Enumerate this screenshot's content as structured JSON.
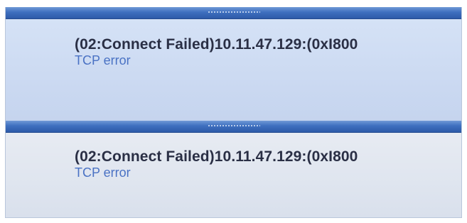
{
  "notifications": [
    {
      "title": "(02:Connect Failed)10.11.47.129:(0xI800",
      "detail": "TCP error"
    },
    {
      "title": "(02:Connect Failed)10.11.47.129:(0xI800",
      "detail": "TCP error"
    }
  ],
  "colors": {
    "header_bar": "#3e6fbf",
    "panel_active_bg": "#ccdaf2",
    "panel_inactive_bg": "#dfe5ef",
    "title_text": "#2a2f45",
    "detail_text": "#4a72c4"
  }
}
